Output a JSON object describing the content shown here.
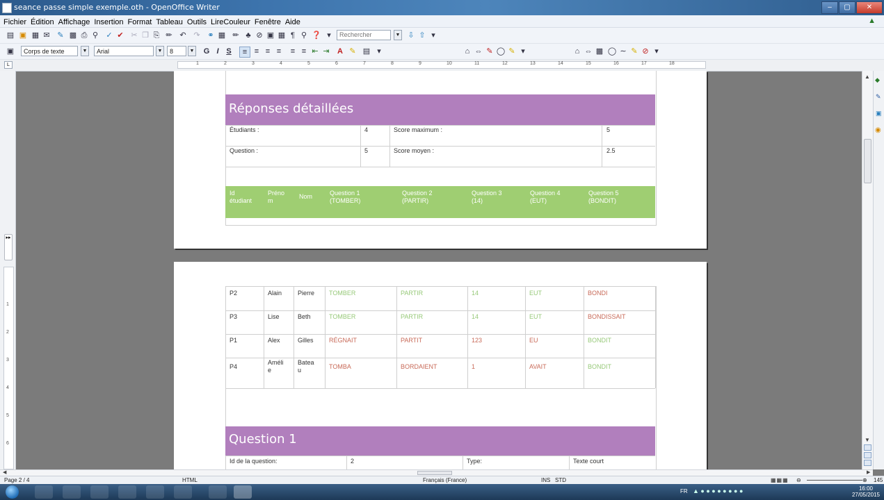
{
  "window": {
    "title": "seance passe simple exemple.oth - OpenOffice Writer"
  },
  "menu": [
    "Fichier",
    "Édition",
    "Affichage",
    "Insertion",
    "Format",
    "Tableau",
    "Outils",
    "LireCouleur",
    "Fenêtre",
    "Aide"
  ],
  "toolbar": {
    "search_placeholder": "Rechercher"
  },
  "format_toolbar": {
    "style": "Corps de texte",
    "font": "Arial",
    "size": "8",
    "bold": "G",
    "italic": "I",
    "underline": "S"
  },
  "ruler": {
    "marks": [
      "1",
      "2",
      "3",
      "4",
      "5",
      "6",
      "7",
      "8",
      "9",
      "10",
      "11",
      "12",
      "13",
      "14",
      "15",
      "16",
      "17",
      "18"
    ]
  },
  "vruler": {
    "marks": [
      "1",
      "2",
      "3",
      "4",
      "5",
      "6"
    ]
  },
  "summary": {
    "title": "Réponses détaillées",
    "students_label": "Étudiants :",
    "students_value": "4",
    "max_label": "Score maximum :",
    "max_value": "5",
    "questions_label": "Question :",
    "questions_value": "5",
    "avg_label": "Score moyen :",
    "avg_value": "2.5"
  },
  "results_header": {
    "id": [
      "Id",
      "étudiant"
    ],
    "prenom": [
      "Préno",
      "m"
    ],
    "nom": "Nom",
    "q1": [
      "Question 1",
      "(TOMBER)"
    ],
    "q2": [
      "Question 2",
      "(PARTIR)"
    ],
    "q3": [
      "Question 3",
      "(14)"
    ],
    "q4": [
      "Question 4",
      "(EUT)"
    ],
    "q5": [
      "Question 5",
      "(BONDIT)"
    ]
  },
  "rows": [
    {
      "id": "P2",
      "prenom": "Alain",
      "nom": "Pierre",
      "q1": "TOMBER",
      "q2": "PARTIR",
      "q3": "14",
      "q4": "EUT",
      "q5": "BONDI"
    },
    {
      "id": "P3",
      "prenom": "Lise",
      "nom": "Beth",
      "q1": "TOMBER",
      "q2": "PARTIR",
      "q3": "14",
      "q4": "EUT",
      "q5": "BONDISSAIT"
    },
    {
      "id": "P1",
      "prenom": "Alex",
      "nom": "Gilles",
      "q1": "RÉGNAIT",
      "q2": "PARTIT",
      "q3": "123",
      "q4": "EU",
      "q5": "BONDIT"
    },
    {
      "id": "P4",
      "prenom": [
        "Améli",
        "e"
      ],
      "nom": [
        "Batea",
        "u"
      ],
      "q1": "TOMBA",
      "q2": "BORDAIENT",
      "q3": "1",
      "q4": "AVAIT",
      "q5": "BONDIT"
    }
  ],
  "question1": {
    "title": "Question 1",
    "id_label": "Id de la question:",
    "id_value": "2",
    "type_label": "Type:",
    "type_value": "Texte court"
  },
  "status": {
    "page": "Page 2 / 4",
    "mode": "HTML",
    "language": "Français (France)",
    "ins": "INS",
    "std": "STD",
    "zoom": "145"
  },
  "clock": {
    "time": "16:00",
    "date": "27/05/2015"
  },
  "tray": {
    "lang": "FR"
  },
  "colors": {
    "purple": "#b17fbd",
    "green": "#9fce72",
    "correct": "#97c979",
    "wrong": "#c86a58"
  }
}
